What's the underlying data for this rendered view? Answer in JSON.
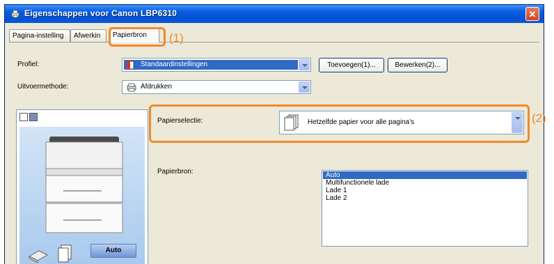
{
  "window": {
    "title": "Eigenschappen voor Canon LBP6310",
    "close_glyph": "✕"
  },
  "tabs": [
    {
      "label": "Pagina-instelling",
      "active": false
    },
    {
      "label": "Afwerkin",
      "active": false
    },
    {
      "label": "Papierbron",
      "active": true
    }
  ],
  "callouts": {
    "one": "(1)",
    "two": "(2)"
  },
  "profile": {
    "label": "Profiel:",
    "value": "Standaardinstellingen",
    "add_button": "Toevoegen(1)...",
    "edit_button": "Bewerken(2)..."
  },
  "output_method": {
    "label": "Uitvoermethode:",
    "value": "Afdrukken"
  },
  "paper_selection": {
    "label": "Papierselectie:",
    "value": "Hetzelfde papier voor alle pagina's"
  },
  "paper_source": {
    "label": "Papierbron:",
    "options": [
      "Auto",
      "Multifunctionele lade",
      "Lade 1",
      "Lade 2"
    ],
    "selected_index": 0
  },
  "preview": {
    "auto_button": "Auto"
  },
  "colors": {
    "accent_orange": "#f08a2c",
    "title_blue": "#0a5fe0",
    "selection_blue": "#316ac5"
  }
}
